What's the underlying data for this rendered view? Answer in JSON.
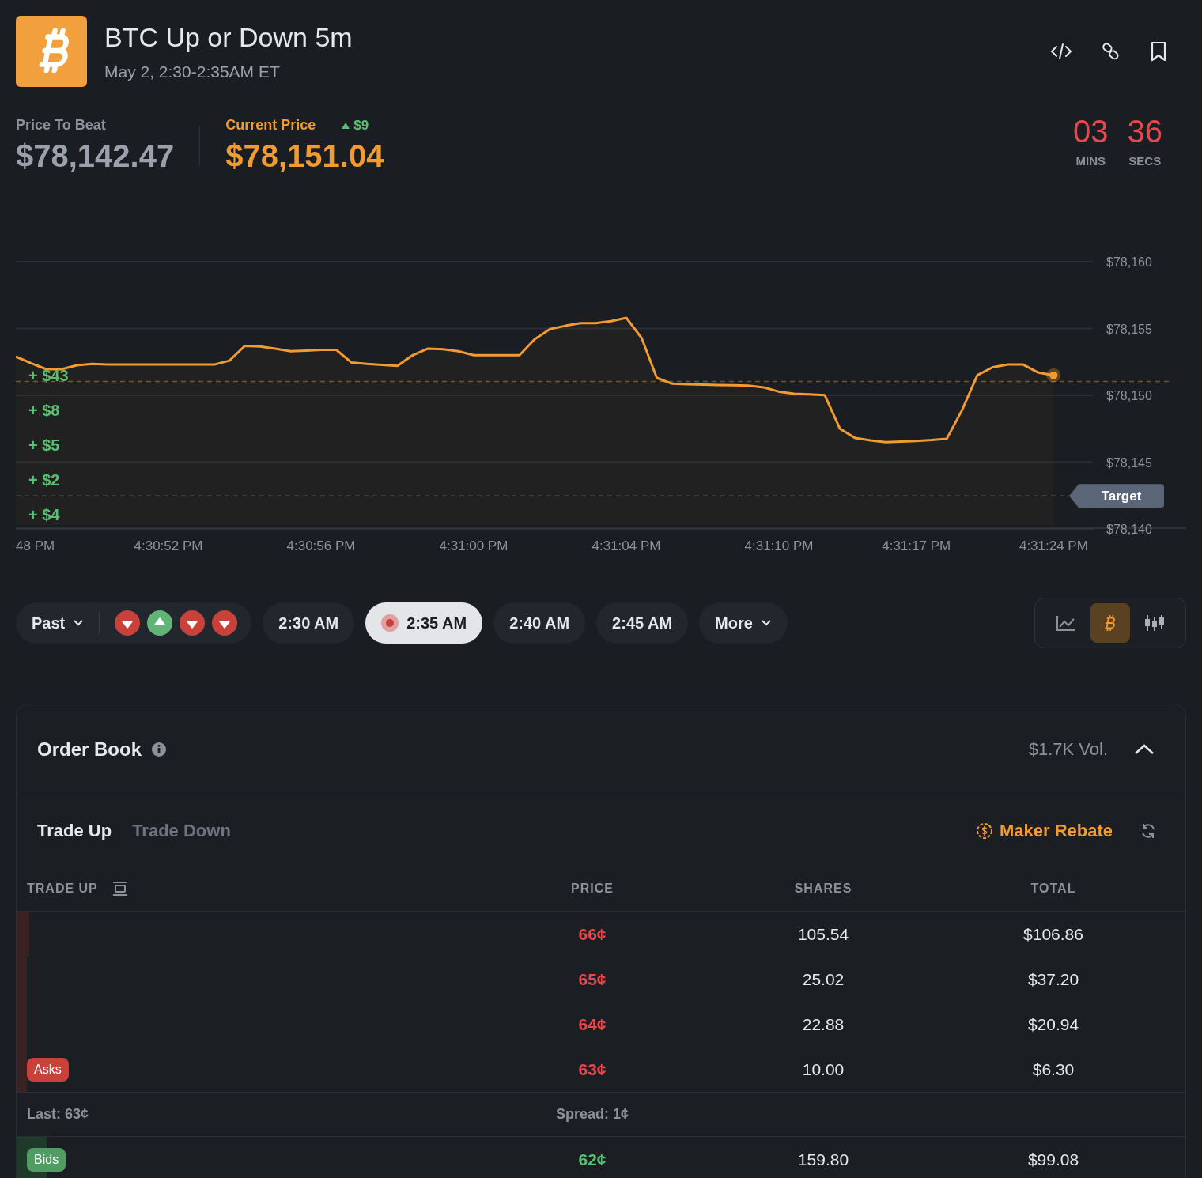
{
  "header": {
    "title": "BTC Up or Down 5m",
    "subtitle": "May 2, 2:30-2:35AM ET"
  },
  "prices": {
    "price_to_beat": {
      "label": "Price To Beat",
      "value": "$78,142.47"
    },
    "current_price": {
      "label": "Current Price",
      "change": "$9",
      "value": "$78,151.04"
    }
  },
  "countdown": [
    {
      "value": "03",
      "unit": "MINS"
    },
    {
      "value": "36",
      "unit": "SECS"
    }
  ],
  "chart": {
    "deltas": [
      "+ $43",
      "+ $8",
      "+ $5",
      "+ $2",
      "+ $4"
    ],
    "chart_data": {
      "type": "area",
      "grid": true,
      "ylim": [
        78140,
        78160
      ],
      "categories": [
        null,
        "48 PM",
        null,
        null,
        null,
        null,
        null,
        null,
        null,
        null,
        "4:30:52 PM",
        null,
        null,
        null,
        null,
        null,
        null,
        null,
        null,
        null,
        "4:30:56 PM",
        null,
        null,
        null,
        null,
        null,
        null,
        null,
        null,
        null,
        "4:31:00 PM",
        null,
        null,
        null,
        null,
        null,
        null,
        null,
        null,
        null,
        "4:31:04 PM",
        null,
        null,
        null,
        null,
        null,
        null,
        null,
        null,
        null,
        "4:31:10 PM",
        null,
        null,
        null,
        null,
        null,
        null,
        null,
        null,
        "4:31:17 PM",
        null,
        null,
        null,
        null,
        null,
        null,
        null,
        null,
        "4:31:24 PM"
      ],
      "values": [
        78152.9,
        78152.4,
        78151.95,
        78151.95,
        78152.25,
        78152.35,
        78152.3,
        78152.3,
        78152.3,
        78152.3,
        78152.3,
        78152.3,
        78152.3,
        78152.3,
        78152.6,
        78153.7,
        78153.65,
        78153.5,
        78153.3,
        78153.35,
        78153.4,
        78153.4,
        78152.45,
        78152.35,
        78152.27,
        78152.2,
        78153.0,
        78153.5,
        78153.45,
        78153.3,
        78153.0,
        78153.0,
        78153.0,
        78153.0,
        78154.2,
        78154.95,
        78155.2,
        78155.4,
        78155.4,
        78155.55,
        78155.8,
        78154.3,
        78151.3,
        78150.87,
        78150.82,
        78150.8,
        78150.77,
        78150.75,
        78150.72,
        78150.6,
        78150.27,
        78150.12,
        78150.07,
        78150.02,
        78147.5,
        78146.8,
        78146.62,
        78146.5,
        78146.54,
        78146.58,
        78146.65,
        78146.75,
        78148.9,
        78151.5,
        78152.1,
        78152.3,
        78152.3,
        78151.7,
        78151.5
      ],
      "yticks": [
        {
          "value": 78160,
          "label": "$78,160"
        },
        {
          "value": 78155,
          "label": "$78,155"
        },
        {
          "value": 78150,
          "label": "$78,150"
        },
        {
          "value": 78145,
          "label": "$78,145"
        },
        {
          "value": 78140,
          "label": "$78,140"
        }
      ]
    },
    "target_label": "Target"
  },
  "timeline": {
    "past_label": "Past",
    "past_results": [
      {
        "kind": "down"
      },
      {
        "kind": "up"
      },
      {
        "kind": "down"
      },
      {
        "kind": "down"
      }
    ],
    "times": [
      {
        "label": "2:30 AM",
        "selected": false,
        "live": false
      },
      {
        "label": "2:35 AM",
        "selected": true,
        "live": true
      },
      {
        "label": "2:40 AM",
        "selected": false,
        "live": false
      },
      {
        "label": "2:45 AM",
        "selected": false,
        "live": false
      }
    ],
    "more_label": "More",
    "view_modes": [
      {
        "kind": "line",
        "selected": false
      },
      {
        "kind": "coin",
        "selected": true
      },
      {
        "kind": "candles",
        "selected": false
      }
    ]
  },
  "order_book": {
    "title": "Order Book",
    "volume": "$1.7K Vol.",
    "expanded": true,
    "tabs": [
      {
        "label": "Trade Up",
        "selected": true
      },
      {
        "label": "Trade Down",
        "selected": false
      }
    ],
    "maker_rebate": "Maker Rebate",
    "columns": [
      "TRADE UP",
      "PRICE",
      "SHARES",
      "TOTAL"
    ],
    "asks": [
      {
        "price": "66¢",
        "shares": "105.54",
        "total": "$106.86",
        "level": 0.011
      },
      {
        "price": "65¢",
        "shares": "25.02",
        "total": "$37.20",
        "level": 0.009
      },
      {
        "price": "64¢",
        "shares": "22.88",
        "total": "$20.94",
        "level": 0.009
      },
      {
        "price": "63¢",
        "shares": "10.00",
        "total": "$6.30",
        "level": 0.009
      }
    ],
    "asks_label": "Asks",
    "last": "Last: 63¢",
    "spread": "Spread: 1¢",
    "bids": [
      {
        "price": "62¢",
        "shares": "159.80",
        "total": "$99.08",
        "level": 0.026
      }
    ],
    "bids_label": "Bids"
  }
}
